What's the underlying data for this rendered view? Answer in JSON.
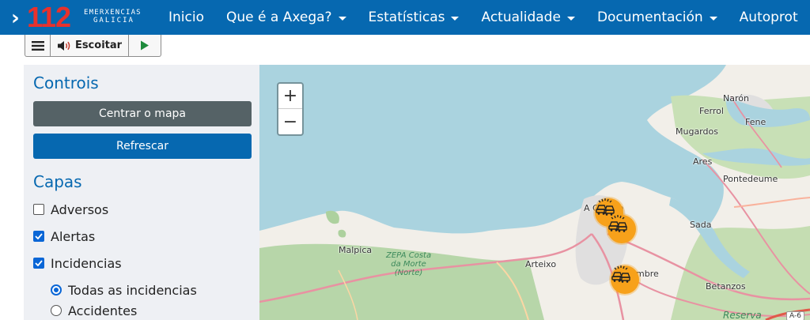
{
  "header": {
    "logo": {
      "number": "112",
      "line1": "EMERXENCIAS",
      "line2": "GALICIA",
      "brand_color": "#e8312c"
    },
    "nav": [
      {
        "label": "Inicio",
        "has_dropdown": false
      },
      {
        "label": "Que é a Axega?",
        "has_dropdown": true
      },
      {
        "label": "Estatísticas",
        "has_dropdown": true
      },
      {
        "label": "Actualidade",
        "has_dropdown": true
      },
      {
        "label": "Documentación",
        "has_dropdown": true
      },
      {
        "label": "Autoprot",
        "has_dropdown": false
      }
    ],
    "bg_color": "#0668b0"
  },
  "audio_toolbar": {
    "listen_label": "Escoitar",
    "icons": [
      "menu-icon",
      "speaker-icon",
      "play-icon"
    ]
  },
  "sidebar": {
    "controls_title": "Controis",
    "center_button": "Centrar o mapa",
    "refresh_button": "Refrescar",
    "layers_title": "Capas",
    "layers": [
      {
        "label": "Adversos",
        "checked": false
      },
      {
        "label": "Alertas",
        "checked": true
      },
      {
        "label": "Incidencias",
        "checked": true
      }
    ],
    "incident_filter": [
      {
        "label": "Todas as incidencias",
        "selected": true
      },
      {
        "label": "Accidentes",
        "selected": false
      }
    ]
  },
  "map": {
    "zoom_in": "+",
    "zoom_out": "−",
    "labels": {
      "naron": "Narón",
      "ferrol": "Ferrol",
      "fene": "Fene",
      "mugardos": "Mugardos",
      "ares": "Ares",
      "pontedeume": "Pontedeume",
      "a_coruna": "A Coruña",
      "sada": "Sada",
      "malpica": "Malpica",
      "zepa": "ZEPA Costa\nda Morte\n(Norte)",
      "arteixo": "Arteixo",
      "cambre": "mbre",
      "betanzos": "Betanzos",
      "reserva": "Reserva",
      "road_a6": "A-6"
    },
    "markers": [
      {
        "name": "incident-marker-1",
        "icon": "car-crash-icon"
      },
      {
        "name": "incident-marker-2",
        "icon": "car-crash-icon"
      },
      {
        "name": "incident-marker-3",
        "icon": "car-crash-icon"
      }
    ],
    "colors": {
      "sea": "#aad3df",
      "land": "#f2efe9",
      "forest": "#add19e",
      "road": "#e892a2",
      "marker": "#f7a11a"
    }
  }
}
